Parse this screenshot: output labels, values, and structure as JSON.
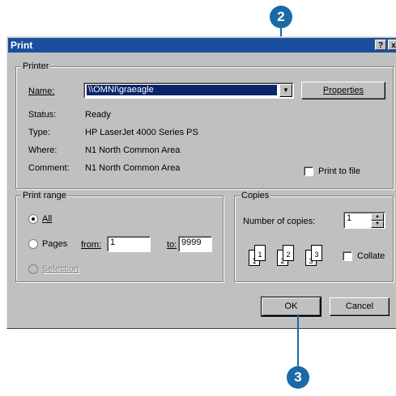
{
  "callouts": {
    "top": "2",
    "bottom": "3"
  },
  "dialog": {
    "title": "Print",
    "help_button": "?",
    "close_button": "x"
  },
  "printer": {
    "group_title": "Printer",
    "name_label": "Name:",
    "name_value": "\\\\OMNI\\graeagle",
    "properties_label": "Properties",
    "status_label": "Status:",
    "status_value": "Ready",
    "type_label": "Type:",
    "type_value": "HP LaserJet 4000 Series PS",
    "where_label": "Where:",
    "where_value": "N1 North Common Area",
    "comment_label": "Comment:",
    "comment_value": "N1 North Common Area",
    "print_to_file_label": "Print to file"
  },
  "print_range": {
    "group_title": "Print range",
    "all_label": "All",
    "pages_label": "Pages",
    "from_label": "from:",
    "from_value": "1",
    "to_label": "to:",
    "to_value": "9999",
    "selection_label": "Selection"
  },
  "copies": {
    "group_title": "Copies",
    "number_label": "Number of copies:",
    "number_value": "1",
    "collate_label": "Collate",
    "page_labels": [
      "1",
      "1",
      "2",
      "2",
      "3",
      "3"
    ]
  },
  "buttons": {
    "ok": "OK",
    "cancel": "Cancel"
  },
  "colors": {
    "accent": "#1a6aa6",
    "titlebar": "#1a4fa0",
    "face": "#c0c0c0"
  }
}
